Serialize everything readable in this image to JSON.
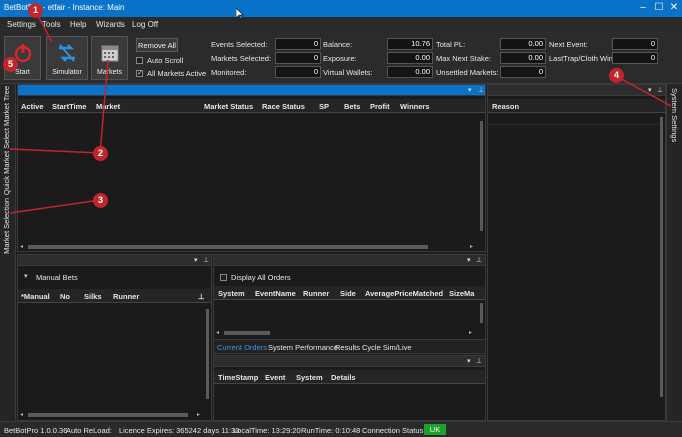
{
  "window": {
    "title": "BetBotPro - Betfair - Instance: Main",
    "title_visible": "BetBotPro - etfair - Instance: Main"
  },
  "menu": {
    "items": [
      "Settings",
      "Tools",
      "Help",
      "Wizards",
      "Log Off"
    ]
  },
  "toolbar": {
    "start_label": "Start",
    "simulator_label": "Simulator",
    "markets_label": "Markets",
    "remove_all_label": "Remove All",
    "auto_scroll_label": "Auto Scroll",
    "all_markets_active_label": "All Markets Active",
    "auto_scroll_checked": false,
    "all_markets_active_checked": true
  },
  "stats": {
    "events_selected_label": "Events Selected:",
    "events_selected_value": "0",
    "markets_selected_label": "Markets Selected:",
    "markets_selected_value": "0",
    "monitored_label": "Monitored:",
    "monitored_value": "0",
    "balance_label": "Balance:",
    "balance_value": "10.76",
    "exposure_label": "Exposure:",
    "exposure_value": "0.00",
    "virtual_wallets_label": "Virtual Wallets:",
    "virtual_wallets_value": "0.00",
    "total_pl_label": "Total PL:",
    "total_pl_value": "0.00",
    "max_next_stake_label": "Max Next Stake:",
    "max_next_stake_value": "0.00",
    "unsettled_markets_label": "Unsettled Markets:",
    "unsettled_markets_value": "0",
    "next_event_label": "Next Event:",
    "next_event_value": "0",
    "last_trap_label": "LastTrap/Cloth Win:",
    "last_trap_value": "0"
  },
  "left_tabs": [
    "Market Tree",
    "Quick Market Select",
    "Market Selection"
  ],
  "right_tabs": [
    "System Settings"
  ],
  "markets_grid": {
    "columns": [
      "Active",
      "StartTime",
      "Market",
      "Market Status",
      "Race Status",
      "SP",
      "Bets",
      "Profit",
      "Winners"
    ]
  },
  "reason_grid": {
    "columns": [
      "Reason"
    ]
  },
  "manual_bets": {
    "title": "Manual Bets",
    "columns": [
      "*Manual",
      "No",
      "Silks",
      "Runner"
    ]
  },
  "orders": {
    "display_all_label": "Display All Orders",
    "columns": [
      "System",
      "EventName",
      "Runner",
      "Side",
      "AveragePriceMatched",
      "SizeMa"
    ],
    "tabs": [
      "Current Orders",
      "System Performance",
      "Results",
      "Cycle Sim/Live"
    ],
    "active_tab": "Current Orders"
  },
  "log_grid": {
    "columns": [
      "TimeStamp",
      "Event",
      "System",
      "Details"
    ]
  },
  "status": {
    "version": "BetBotPro 1.0.0.36",
    "auto_reload": "Auto ReLoad:",
    "licence": "Licence Expires: 365242 days 11:30",
    "local_time": "LocalTime: 13:29:20",
    "run_time": "RunTime: 0:10:48",
    "connection_label": "Connection Status:",
    "connection_value": "UK"
  },
  "annotations": [
    "1",
    "2",
    "3",
    "4",
    "5"
  ],
  "colors": {
    "accent": "#0a72c9",
    "annotation": "#c0262b",
    "status_ok": "#1da12a"
  }
}
